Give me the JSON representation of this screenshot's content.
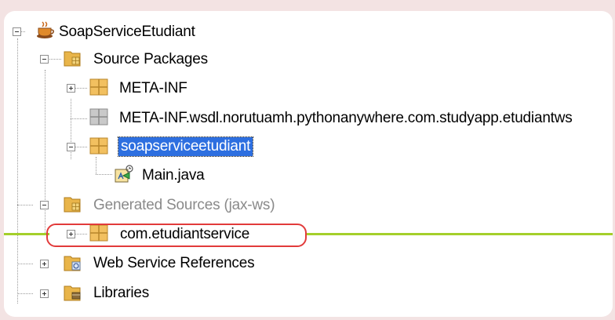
{
  "tree": {
    "project": {
      "label": "SoapServiceEtudiant",
      "icon": "coffee-cup-icon"
    },
    "nodes": [
      {
        "label": "Source Packages",
        "icon": "source-packages-folder-icon",
        "expanded": true
      },
      {
        "label": "META-INF",
        "icon": "package-icon",
        "expanded": false
      },
      {
        "label": "META-INF.wsdl.norutuamh.pythonanywhere.com.studyapp.etudiantws",
        "icon": "empty-package-icon"
      },
      {
        "label": "soapserviceetudiant",
        "icon": "package-icon",
        "expanded": true,
        "selected": true
      },
      {
        "label": "Main.java",
        "icon": "java-class-icon"
      },
      {
        "label": "Generated Sources (jax-ws)",
        "icon": "generated-sources-folder-icon",
        "expanded": true
      },
      {
        "label": "com.etudiantservice",
        "icon": "package-icon",
        "expanded": false
      },
      {
        "label": "Web Service References",
        "icon": "web-service-folder-icon",
        "expanded": false
      },
      {
        "label": "Libraries",
        "icon": "libraries-folder-icon",
        "expanded": false
      }
    ]
  },
  "colors": {
    "selection": "#2d6fe0",
    "annotation_circle": "#e23b3b",
    "annotation_line": "#a4cf2a",
    "background": "#f3e3e3"
  }
}
